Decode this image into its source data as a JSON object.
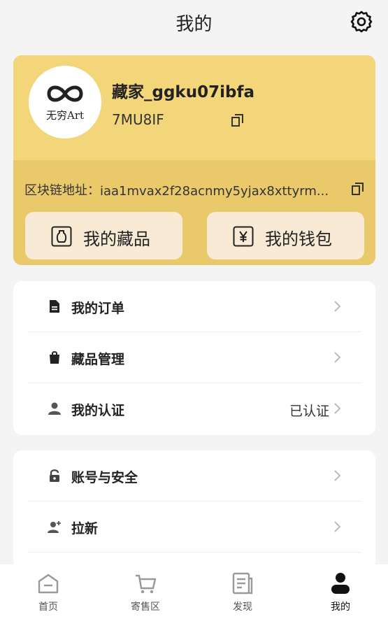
{
  "header": {
    "title": "我的",
    "settings_icon": "gear-icon"
  },
  "profile": {
    "avatar_logo_text": "无穷Art",
    "username": "藏家_ggku07ibfa",
    "user_id": "7MU8IF",
    "chain_label": "区块链地址：",
    "chain_address": "iaa1mvax2f28acnmy5yjax8xttyrm...",
    "actions": [
      {
        "label": "我的藏品",
        "icon": "vase-icon"
      },
      {
        "label": "我的钱包",
        "icon": "wallet-yen-icon"
      }
    ],
    "colors": {
      "card_top": "#f3d679",
      "card_bottom": "#eac96a",
      "button_bg": "#f8ead4"
    }
  },
  "menu_group_1": [
    {
      "label": "我的订单",
      "icon": "document-icon",
      "status": ""
    },
    {
      "label": "藏品管理",
      "icon": "shopping-bag-icon",
      "status": ""
    },
    {
      "label": "我的认证",
      "icon": "person-icon",
      "status": "已认证"
    }
  ],
  "menu_group_2": [
    {
      "label": "账号与安全",
      "icon": "lock-icon",
      "status": ""
    },
    {
      "label": "拉新",
      "icon": "add-person-icon",
      "status": ""
    }
  ],
  "tabs": [
    {
      "label": "首页",
      "icon": "home-icon",
      "active": false
    },
    {
      "label": "寄售区",
      "icon": "cart-icon",
      "active": false
    },
    {
      "label": "发现",
      "icon": "news-icon",
      "active": false
    },
    {
      "label": "我的",
      "icon": "profile-icon",
      "active": true
    }
  ]
}
